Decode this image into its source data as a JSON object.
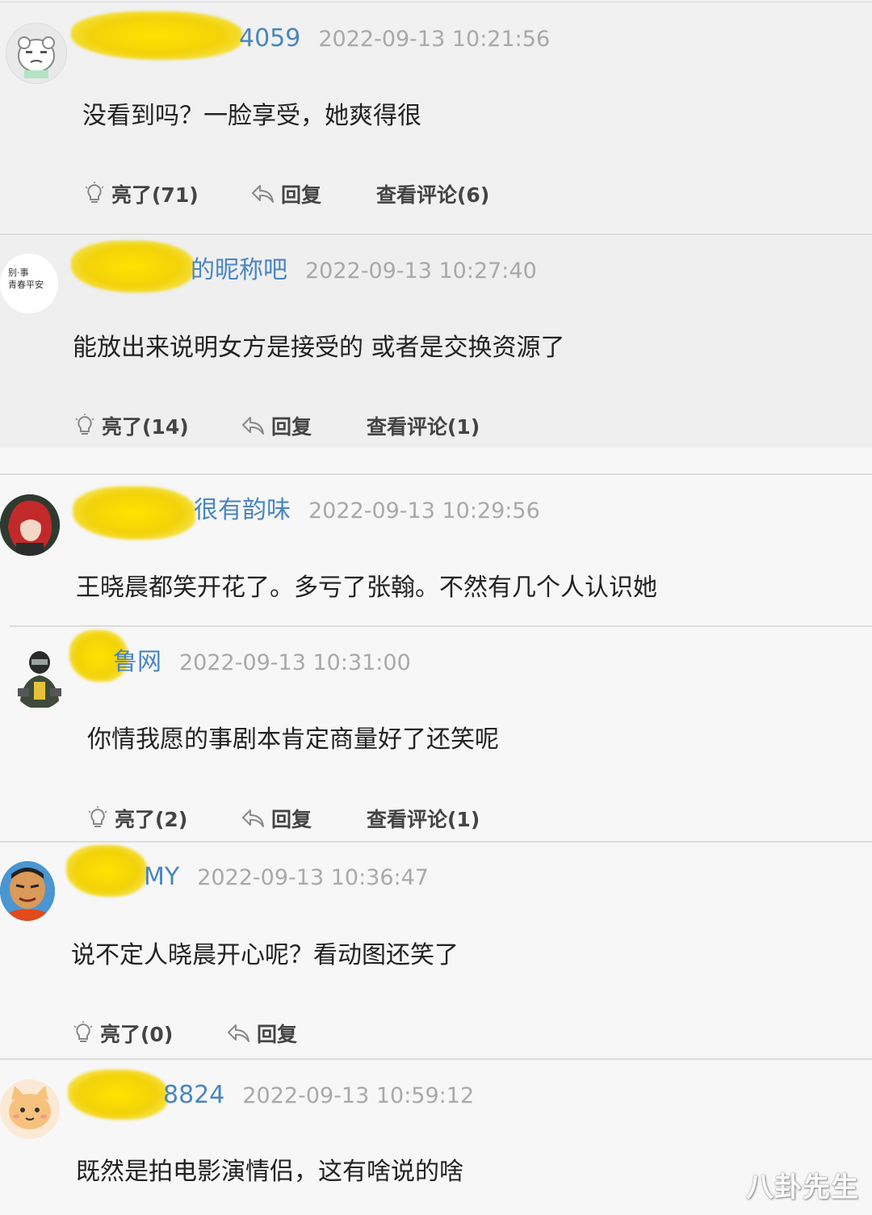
{
  "comments": [
    {
      "username_suffix": "4059",
      "timestamp": "2022-09-13 10:21:56",
      "text": "没看到吗？一脸享受，她爽得很",
      "actions": {
        "like": "亮了(71)",
        "reply": "回复",
        "view": "查看评论(6)"
      }
    },
    {
      "username_suffix": "的昵称吧",
      "timestamp": "2022-09-13 10:27:40",
      "text": "能放出来说明女方是接受的 或者是交换资源了",
      "avatar_text": "别·事\n青春平安",
      "actions": {
        "like": "亮了(14)",
        "reply": "回复",
        "view": "查看评论(1)"
      }
    },
    {
      "username_suffix": "很有韵味",
      "timestamp": "2022-09-13 10:29:56",
      "text": "王晓晨都笑开花了。多亏了张翰。不然有几个人认识她"
    },
    {
      "username_suffix": "鲁网",
      "timestamp": "2022-09-13 10:31:00",
      "text": "你情我愿的事剧本肯定商量好了还笑呢",
      "actions": {
        "like": "亮了(2)",
        "reply": "回复",
        "view": "查看评论(1)"
      }
    },
    {
      "username_suffix": "MY",
      "timestamp": "2022-09-13 10:36:47",
      "text": "说不定人晓晨开心呢？看动图还笑了",
      "actions": {
        "like": "亮了(0)",
        "reply": "回复"
      }
    },
    {
      "username_suffix": "8824",
      "timestamp": "2022-09-13 10:59:12",
      "text": "既然是拍电影演情侣，这有啥说的啥"
    }
  ],
  "watermark": "八卦先生",
  "colors": {
    "username": "#4a86c0",
    "timestamp": "#a9a9a9",
    "redaction": "#f2d20a"
  }
}
